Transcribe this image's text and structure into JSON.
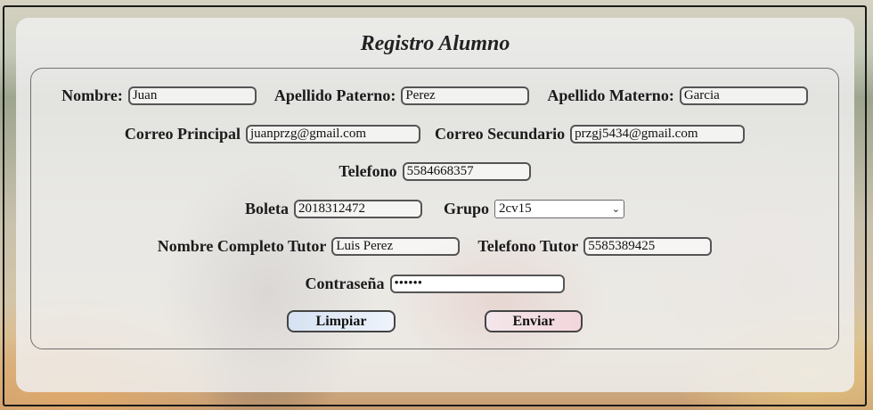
{
  "form": {
    "title": "Registro Alumno",
    "fields": {
      "nombre": {
        "label": "Nombre:",
        "value": "Juan"
      },
      "apellido_paterno": {
        "label": "Apellido Paterno:",
        "value": "Perez"
      },
      "apellido_materno": {
        "label": "Apellido Materno:",
        "value": "Garcia"
      },
      "correo_principal": {
        "label": "Correo Principal",
        "value": "juanprzg@gmail.com"
      },
      "correo_secundario": {
        "label": "Correo Secundario",
        "value": "przgj5434@gmail.com"
      },
      "telefono": {
        "label": "Telefono",
        "value": "5584668357"
      },
      "boleta": {
        "label": "Boleta",
        "value": "2018312472"
      },
      "grupo": {
        "label": "Grupo",
        "value": "2cv15"
      },
      "nombre_tutor": {
        "label": "Nombre Completo Tutor",
        "value": "Luis Perez"
      },
      "telefono_tutor": {
        "label": "Telefono Tutor",
        "value": "5585389425"
      },
      "contrasena": {
        "label": "Contraseña",
        "value": "••••••"
      }
    },
    "buttons": {
      "limpiar": "Limpiar",
      "enviar": "Enviar"
    }
  }
}
